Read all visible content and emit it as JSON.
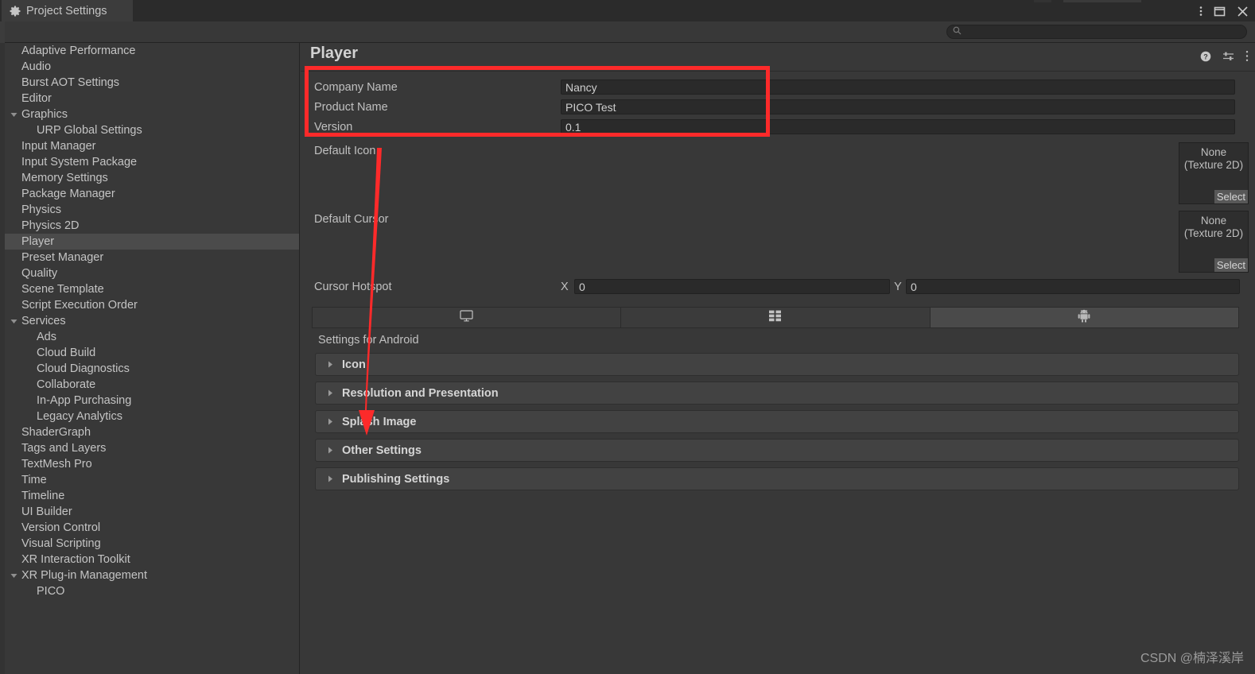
{
  "window": {
    "tab_label": "Project Settings",
    "tab_icon": "gear-icon",
    "buttons": [
      {
        "name": "kebab-menu-icon",
        "label": "⋮"
      },
      {
        "name": "maximize-icon",
        "label": "▢"
      },
      {
        "name": "close-icon",
        "label": "✕"
      }
    ]
  },
  "search": {
    "placeholder": "",
    "value": "",
    "icon": "search-icon"
  },
  "sidebar": {
    "items": [
      {
        "label": "Adaptive Performance",
        "level": 0,
        "expandable": false,
        "selected": false
      },
      {
        "label": "Audio",
        "level": 0,
        "expandable": false,
        "selected": false
      },
      {
        "label": "Burst AOT Settings",
        "level": 0,
        "expandable": false,
        "selected": false
      },
      {
        "label": "Editor",
        "level": 0,
        "expandable": false,
        "selected": false
      },
      {
        "label": "Graphics",
        "level": 0,
        "expandable": true,
        "expanded": true,
        "selected": false
      },
      {
        "label": "URP Global Settings",
        "level": 1,
        "expandable": false,
        "selected": false
      },
      {
        "label": "Input Manager",
        "level": 0,
        "expandable": false,
        "selected": false
      },
      {
        "label": "Input System Package",
        "level": 0,
        "expandable": false,
        "selected": false
      },
      {
        "label": "Memory Settings",
        "level": 0,
        "expandable": false,
        "selected": false
      },
      {
        "label": "Package Manager",
        "level": 0,
        "expandable": false,
        "selected": false
      },
      {
        "label": "Physics",
        "level": 0,
        "expandable": false,
        "selected": false
      },
      {
        "label": "Physics 2D",
        "level": 0,
        "expandable": false,
        "selected": false
      },
      {
        "label": "Player",
        "level": 0,
        "expandable": false,
        "selected": true
      },
      {
        "label": "Preset Manager",
        "level": 0,
        "expandable": false,
        "selected": false
      },
      {
        "label": "Quality",
        "level": 0,
        "expandable": false,
        "selected": false
      },
      {
        "label": "Scene Template",
        "level": 0,
        "expandable": false,
        "selected": false
      },
      {
        "label": "Script Execution Order",
        "level": 0,
        "expandable": false,
        "selected": false
      },
      {
        "label": "Services",
        "level": 0,
        "expandable": true,
        "expanded": true,
        "selected": false
      },
      {
        "label": "Ads",
        "level": 1,
        "expandable": false,
        "selected": false
      },
      {
        "label": "Cloud Build",
        "level": 1,
        "expandable": false,
        "selected": false
      },
      {
        "label": "Cloud Diagnostics",
        "level": 1,
        "expandable": false,
        "selected": false
      },
      {
        "label": "Collaborate",
        "level": 1,
        "expandable": false,
        "selected": false
      },
      {
        "label": "In-App Purchasing",
        "level": 1,
        "expandable": false,
        "selected": false
      },
      {
        "label": "Legacy Analytics",
        "level": 1,
        "expandable": false,
        "selected": false
      },
      {
        "label": "ShaderGraph",
        "level": 0,
        "expandable": false,
        "selected": false
      },
      {
        "label": "Tags and Layers",
        "level": 0,
        "expandable": false,
        "selected": false
      },
      {
        "label": "TextMesh Pro",
        "level": 0,
        "expandable": false,
        "selected": false
      },
      {
        "label": "Time",
        "level": 0,
        "expandable": false,
        "selected": false
      },
      {
        "label": "Timeline",
        "level": 0,
        "expandable": false,
        "selected": false
      },
      {
        "label": "UI Builder",
        "level": 0,
        "expandable": false,
        "selected": false
      },
      {
        "label": "Version Control",
        "level": 0,
        "expandable": false,
        "selected": false
      },
      {
        "label": "Visual Scripting",
        "level": 0,
        "expandable": false,
        "selected": false
      },
      {
        "label": "XR Interaction Toolkit",
        "level": 0,
        "expandable": false,
        "selected": false
      },
      {
        "label": "XR Plug-in Management",
        "level": 0,
        "expandable": true,
        "expanded": true,
        "selected": false
      },
      {
        "label": "PICO",
        "level": 1,
        "expandable": false,
        "selected": false
      }
    ]
  },
  "panel": {
    "title": "Player",
    "header_icons": [
      {
        "name": "help-icon",
        "label": "?"
      },
      {
        "name": "preset-icon",
        "label": "preset"
      },
      {
        "name": "kebab-menu-icon",
        "label": "⋮"
      }
    ],
    "identification": [
      {
        "label": "Company Name",
        "value": "Nancy"
      },
      {
        "label": "Product Name",
        "value": "PICO Test"
      },
      {
        "label": "Version",
        "value": "0.1"
      }
    ],
    "default_icon": {
      "label": "Default Icon",
      "value": "None",
      "type": "(Texture 2D)",
      "select_label": "Select"
    },
    "default_cursor": {
      "label": "Default Cursor",
      "value": "None",
      "type": "(Texture 2D)",
      "select_label": "Select"
    },
    "cursor_hotspot": {
      "label": "Cursor Hotspot",
      "x_label": "X",
      "x_value": "0",
      "y_label": "Y",
      "y_value": "0"
    },
    "platform_tabs": [
      {
        "name": "tab-standalone",
        "icon": "monitor-icon",
        "active": false
      },
      {
        "name": "tab-dedicated-server",
        "icon": "server-icon",
        "active": false
      },
      {
        "name": "tab-android",
        "icon": "android-icon",
        "active": true
      }
    ],
    "settings_for": "Settings for Android",
    "foldouts": [
      {
        "label": "Icon",
        "expanded": false
      },
      {
        "label": "Resolution and Presentation",
        "expanded": false
      },
      {
        "label": "Splash Image",
        "expanded": false
      },
      {
        "label": "Other Settings",
        "expanded": false
      },
      {
        "label": "Publishing Settings",
        "expanded": false
      }
    ]
  },
  "annotation": {
    "color": "#fd2a2a",
    "box_target": "identification-fields",
    "arrow_target": "other-settings-foldout"
  },
  "watermark": {
    "text": "CSDN @楠泽溪岸"
  }
}
